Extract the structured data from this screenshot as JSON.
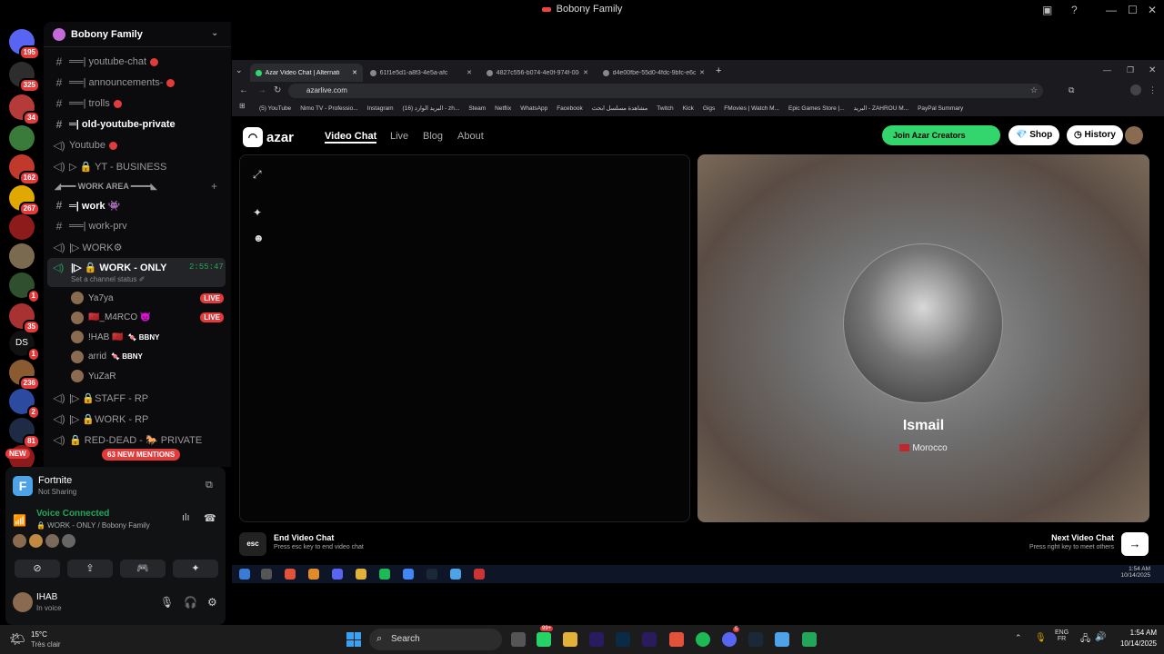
{
  "window": {
    "title": "Bobony Family"
  },
  "servers": [
    {
      "label": "",
      "badge": "195",
      "color": "#5865f2"
    },
    {
      "label": "",
      "badge": "325",
      "color": "#2d2d2d"
    },
    {
      "label": "",
      "badge": "34",
      "color": "#b53a3a"
    },
    {
      "label": "",
      "badge": "",
      "color": "#3a7a3a"
    },
    {
      "label": "",
      "badge": "162",
      "color": "#c0392b"
    },
    {
      "label": "",
      "badge": "267",
      "color": "#e0a800"
    },
    {
      "label": "",
      "badge": "",
      "color": "#8e1b1b"
    },
    {
      "label": "",
      "badge": "",
      "color": "#7a6a50"
    },
    {
      "label": "",
      "badge": "1",
      "color": "#2f4f2f"
    },
    {
      "label": "",
      "badge": "35",
      "color": "#a83232"
    },
    {
      "label": "DS",
      "badge": "1",
      "color": "#111"
    },
    {
      "label": "",
      "badge": "236",
      "color": "#8a5a30"
    },
    {
      "label": "",
      "badge": "2",
      "color": "#2b4aa0"
    },
    {
      "label": "",
      "badge": "81",
      "color": "#1f2a44"
    },
    {
      "label": "",
      "badge": "",
      "color": "#8e1b1b"
    }
  ],
  "new_label": "NEW",
  "guild": {
    "name": "Bobony Family"
  },
  "channels": [
    {
      "icon": "#",
      "name": "══| youtube-chat",
      "dot": true,
      "bright": false
    },
    {
      "icon": "#",
      "name": "══| announcements-",
      "dot": true,
      "bright": false
    },
    {
      "icon": "#",
      "name": "══| trolls",
      "dot": true,
      "bright": false
    },
    {
      "icon": "#",
      "name": "═| old-youtube-private",
      "dot": false,
      "bright": true
    },
    {
      "icon": "◁)",
      "name": "Youtube",
      "dot": true,
      "bright": false
    },
    {
      "icon": "◁)",
      "name": "▷ 🔒 YT - BUSINESS",
      "dot": false,
      "bright": false
    }
  ],
  "category": "◢━━━ WORK AREA ━━━━◣",
  "work_channels": [
    {
      "icon": "#",
      "name": "═| work 👾",
      "bright": true
    },
    {
      "icon": "#",
      "name": "══| work-prv",
      "bright": false
    },
    {
      "icon": "◁)",
      "name": "|▷ WORK⚙",
      "bright": false
    }
  ],
  "active_channel": {
    "name": "|▷ 🔒 WORK - ONLY",
    "timer": "2:55:47",
    "status": "Set a channel status ✐"
  },
  "voice_users": [
    {
      "name": "Ya7ya",
      "tag": "",
      "live": "LIVE"
    },
    {
      "name": "🇲🇦_M4RCO 👿",
      "tag": "",
      "live": "LIVE"
    },
    {
      "name": "!HAB 🇲🇦",
      "tag": "🍬 BBNY",
      "live": ""
    },
    {
      "name": "arrid",
      "tag": "🍬 BBNY",
      "live": ""
    },
    {
      "name": "YuZaR",
      "tag": "",
      "live": ""
    }
  ],
  "more_channels": [
    {
      "icon": "◁)",
      "name": "|▷ 🔒STAFF - RP"
    },
    {
      "icon": "◁)",
      "name": "|▷ 🔒WORK - RP"
    },
    {
      "icon": "◁)",
      "name": "🔒 RED-DEAD - 🐎 PRIVATE"
    }
  ],
  "mentions": "63 NEW MENTIONS",
  "panel": {
    "game": "Fortnite",
    "game_status": "Not Sharing",
    "voice_title": "Voice Connected",
    "voice_channel": "🔒 WORK - ONLY / Bobony Family",
    "user_name": "IHAB",
    "user_status": "In voice"
  },
  "browser": {
    "tabs": [
      {
        "title": "Azar Video Chat | Alternati",
        "active": true
      },
      {
        "title": "61f1e5d1-a8f3-4e5a-afc",
        "active": false
      },
      {
        "title": "4827c556-b074-4e0f-974f-00c",
        "active": false
      },
      {
        "title": "d4e00fbe-55d0-4fdc-9bfc-e6c",
        "active": false
      }
    ],
    "url": "azarlive.com",
    "bookmarks": [
      "(5) YouTube",
      "Nimo TV - Professio...",
      "Instagram",
      "(16) البريد الوارد - zh...",
      "Steam",
      "Netflix",
      "WhatsApp",
      "Facebook",
      "مشاهدة مسلسل ابحث",
      "Twitch",
      "Kick",
      "Gigs",
      "FMovies | Watch M...",
      "Epic Games Store |...",
      "البريد - ZAHROU M...",
      "PayPal Summary"
    ]
  },
  "site": {
    "logo": "azar",
    "nav": [
      {
        "label": "Video Chat",
        "active": true
      },
      {
        "label": "Live",
        "active": false
      },
      {
        "label": "Blog",
        "active": false
      },
      {
        "label": "About",
        "active": false
      }
    ],
    "join_label": "Join Azar Creators",
    "shop_label": "Shop",
    "history_label": "History",
    "peer_name": "Ismail",
    "peer_country": "Morocco",
    "esc_key": "esc",
    "end_title": "End Video Chat",
    "end_sub": "Press esc key to end video chat",
    "next_title": "Next Video Chat",
    "next_sub": "Press right key to meet others"
  },
  "inner_taskbar": {
    "time": "1:54 AM",
    "date": "10/14/2025"
  },
  "taskbar": {
    "weather_temp": "15°C",
    "weather_desc": "Très clair",
    "search": "Search",
    "lang": "ENG",
    "region": "FR",
    "time": "1:54 AM",
    "date": "10/14/2025",
    "badge_whatsapp": "99+",
    "badge_discord": "5"
  }
}
